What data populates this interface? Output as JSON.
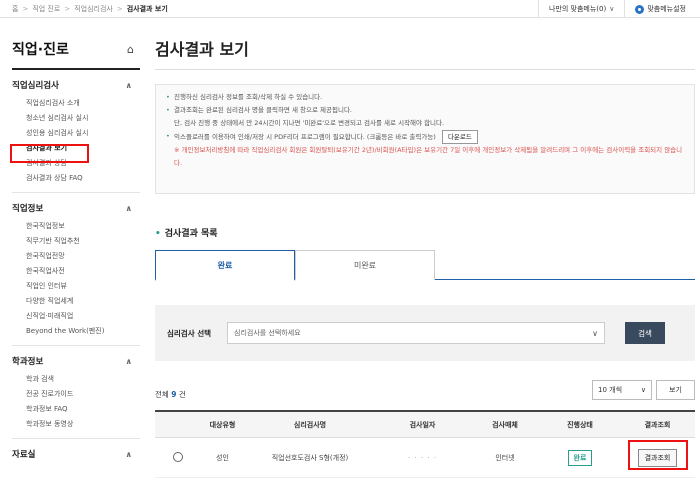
{
  "breadcrumb": {
    "items": [
      "홈",
      "직업 진로",
      "직업심리검사",
      "검사결과 보기"
    ]
  },
  "topbar": {
    "my_menu": "나만의 맞춤메뉴(0)",
    "setting": "맞춤메뉴설정"
  },
  "sidebar": {
    "title": "직업·진로",
    "sections": [
      {
        "title": "직업심리검사",
        "items": [
          "직업심리검사 소개",
          "청소년 심리검사 실시",
          "성인용 심리검사 실시",
          "검사결과 보기",
          "검사결과 상담",
          "검사결과 상담 FAQ"
        ]
      },
      {
        "title": "직업정보",
        "items": [
          "한국직업정보",
          "직무기반 직업추천",
          "한국직업전망",
          "한국직업사전",
          "직업인 인터뷰",
          "다양한 직업세계",
          "신직업·미래직업",
          "Beyond the Work(펜진)"
        ]
      },
      {
        "title": "학과정보",
        "items": [
          "학과 검색",
          "전공 진로가이드",
          "학과정보 FAQ",
          "학과정보 동영상"
        ]
      },
      {
        "title": "자료실",
        "items": []
      }
    ]
  },
  "main": {
    "title": "검사결과 보기",
    "notices": [
      "진행하신 심리검사 정보를 조회/삭제 하실 수 있습니다.",
      "결과조회는 완료된 심리검사 명을 클릭하면 새 창으로 제공됩니다.",
      "단, 검사 진행 중 상태에서 만 24시간이 지나면 '미완료'으로 변경되고 검사를 새로 시작해야 합니다.",
      "익스플로러를 이용하여 인쇄/저장 시 PDF리더 프로그램이 필요합니다. (크롬등은 바로 출력가능)",
      "※ 개인정보처리방침에 따라 직업심리검사 회원은 회원탈퇴(보유기간 2년)/비회원(A타입)은 보유기간 7일 이후에 개인정보가 삭제됨을 알려드리며 그 이후에는 검사이력을 조회되지 않습니다."
    ],
    "download_label": "다운로드",
    "list_title": "검사결과 목록",
    "tabs": [
      "완료",
      "미완료"
    ],
    "search_label": "심리검사 선택",
    "select_placeholder": "심리검사를 선택하세요",
    "search_button": "검색",
    "count_prefix": "전체",
    "count_value": "9",
    "count_suffix": "건",
    "per_page": "10 개씩",
    "view_button": "보기",
    "columns": [
      "",
      "대상유형",
      "심리검사명",
      "검사일자",
      "검사매체",
      "진행상태",
      "결과조회"
    ],
    "rows": [
      {
        "type": "성인",
        "name": "직업선호도검사 S형(개정)",
        "date": "· · · · ·",
        "media": "인터넷",
        "status": "완료",
        "action": "결과조회"
      }
    ]
  }
}
